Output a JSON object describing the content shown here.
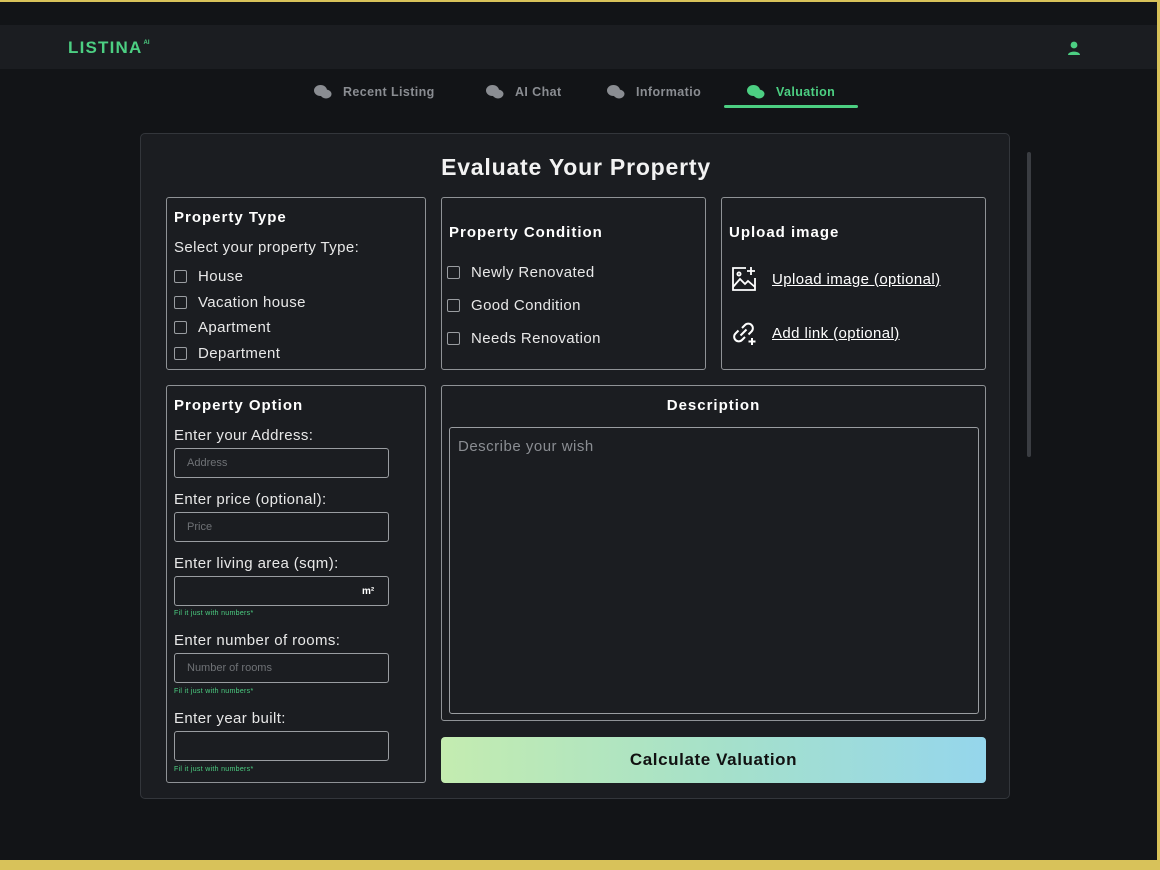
{
  "app": {
    "logo_text": "LISTINA",
    "logo_suffix": "AI",
    "accent_color": "#4ccf82",
    "user_icon": "user-icon"
  },
  "tabs": [
    {
      "label": "Recent Listing",
      "icon": "chat-bubbles-icon",
      "active": false
    },
    {
      "label": "AI Chat",
      "icon": "chat-bubbles-icon",
      "active": false
    },
    {
      "label": "Informatio",
      "icon": "chat-bubbles-icon",
      "active": false
    },
    {
      "label": "Valuation",
      "icon": "chat-bubbles-icon",
      "active": true
    }
  ],
  "page_title": "Evaluate Your Property",
  "property_type": {
    "title": "Property Type",
    "subtitle": "Select your property Type:",
    "options": [
      "House",
      "Vacation house",
      "Apartment",
      "Department"
    ]
  },
  "property_condition": {
    "title": "Property Condition",
    "options": [
      "Newly Renovated",
      "Good Condition",
      "Needs Renovation"
    ]
  },
  "upload": {
    "title": "Upload image",
    "upload_label": "Upload image (optional)",
    "link_label": "Add link (optional)"
  },
  "property_option": {
    "title": "Property Option",
    "address_label": "Enter your Address:",
    "address_placeholder": "Address",
    "price_label": "Enter price (optional):",
    "price_placeholder": "Price",
    "area_label": "Enter living area (sqm):",
    "area_unit": "m²",
    "area_hint": "Fil it just with numbers*",
    "rooms_label": "Enter number of rooms:",
    "rooms_placeholder": "Number of rooms",
    "rooms_hint": "Fil it just with numbers*",
    "year_label": "Enter year built:",
    "year_hint": "Fil it just with numbers*"
  },
  "description": {
    "title": "Description",
    "placeholder": "Describe your wish"
  },
  "calculate_label": "Calculate Valuation"
}
